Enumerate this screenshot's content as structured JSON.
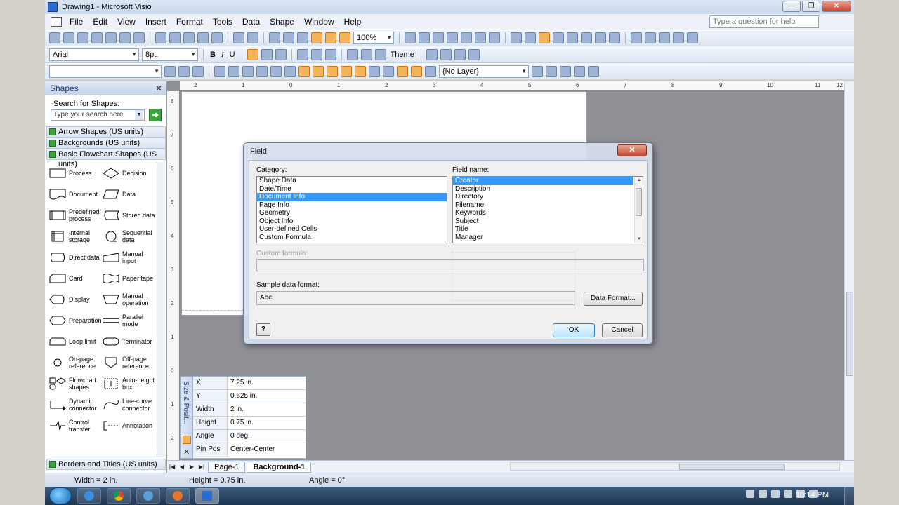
{
  "window": {
    "title": "Drawing1 - Microsoft Visio"
  },
  "menu": {
    "items": [
      "File",
      "Edit",
      "View",
      "Insert",
      "Format",
      "Tools",
      "Data",
      "Shape",
      "Window",
      "Help"
    ],
    "help_placeholder": "Type a question for help"
  },
  "toolbar": {
    "zoom": "100%",
    "font": "Arial",
    "font_size": "8pt.",
    "bold": "B",
    "italic": "I",
    "underline": "U",
    "theme": "Theme",
    "layer": "{No Layer}"
  },
  "shapes_pane": {
    "title": "Shapes",
    "search_label": "Search for Shapes:",
    "search_placeholder": "Type your search here",
    "stencils": [
      "Arrow Shapes (US units)",
      "Backgrounds (US units)",
      "Basic Flowchart Shapes (US units)"
    ],
    "bottom_stencil": "Borders and Titles (US units)",
    "items": [
      "Process",
      "Decision",
      "Document",
      "Data",
      "Predefined process",
      "Stored data",
      "Internal storage",
      "Sequential data",
      "Direct data",
      "Manual input",
      "Card",
      "Paper tape",
      "Display",
      "Manual operation",
      "Preparation",
      "Parallel mode",
      "Loop limit",
      "Terminator",
      "On-page reference",
      "Off-page reference",
      "Flowchart shapes",
      "Auto-height box",
      "Dynamic connector",
      "Line-curve connector",
      "Control transfer",
      "Annotation"
    ]
  },
  "rulers": {
    "horizontal": [
      "2",
      "1",
      "0",
      "1",
      "2",
      "3",
      "4",
      "5",
      "6",
      "7",
      "8",
      "9",
      "10",
      "11",
      "12"
    ],
    "vertical": [
      "8",
      "7",
      "6",
      "5",
      "4",
      "3",
      "2",
      "1",
      "0",
      "1",
      "2"
    ]
  },
  "size_position": {
    "title": "Size & Posit...",
    "rows": [
      {
        "key": "X",
        "value": "7.25 in."
      },
      {
        "key": "Y",
        "value": "0.625 in."
      },
      {
        "key": "Width",
        "value": "2 in."
      },
      {
        "key": "Height",
        "value": "0.75 in."
      },
      {
        "key": "Angle",
        "value": "0 deg."
      },
      {
        "key": "Pin Pos",
        "value": "Center-Center"
      }
    ]
  },
  "page_tabs": [
    "Page-1",
    "Background-1"
  ],
  "status": {
    "width": "Width = 2 in.",
    "height": "Height = 0.75 in.",
    "angle": "Angle = 0°"
  },
  "dialog": {
    "title": "Field",
    "category_label": "Category:",
    "categories": [
      "Shape Data",
      "Date/Time",
      "Document Info",
      "Page Info",
      "Geometry",
      "Object Info",
      "User-defined Cells",
      "Custom Formula"
    ],
    "category_selected": "Document Info",
    "field_name_label": "Field name:",
    "field_names": [
      "Creator",
      "Description",
      "Directory",
      "Filename",
      "Keywords",
      "Subject",
      "Title",
      "Manager"
    ],
    "field_selected": "Creator",
    "custom_formula_label": "Custom formula:",
    "sample_label": "Sample data format:",
    "sample_value": "Abc",
    "data_format_button": "Data Format...",
    "ok_button": "OK",
    "cancel_button": "Cancel",
    "help_button": "?"
  },
  "taskbar": {
    "clock": "10:14 PM"
  }
}
